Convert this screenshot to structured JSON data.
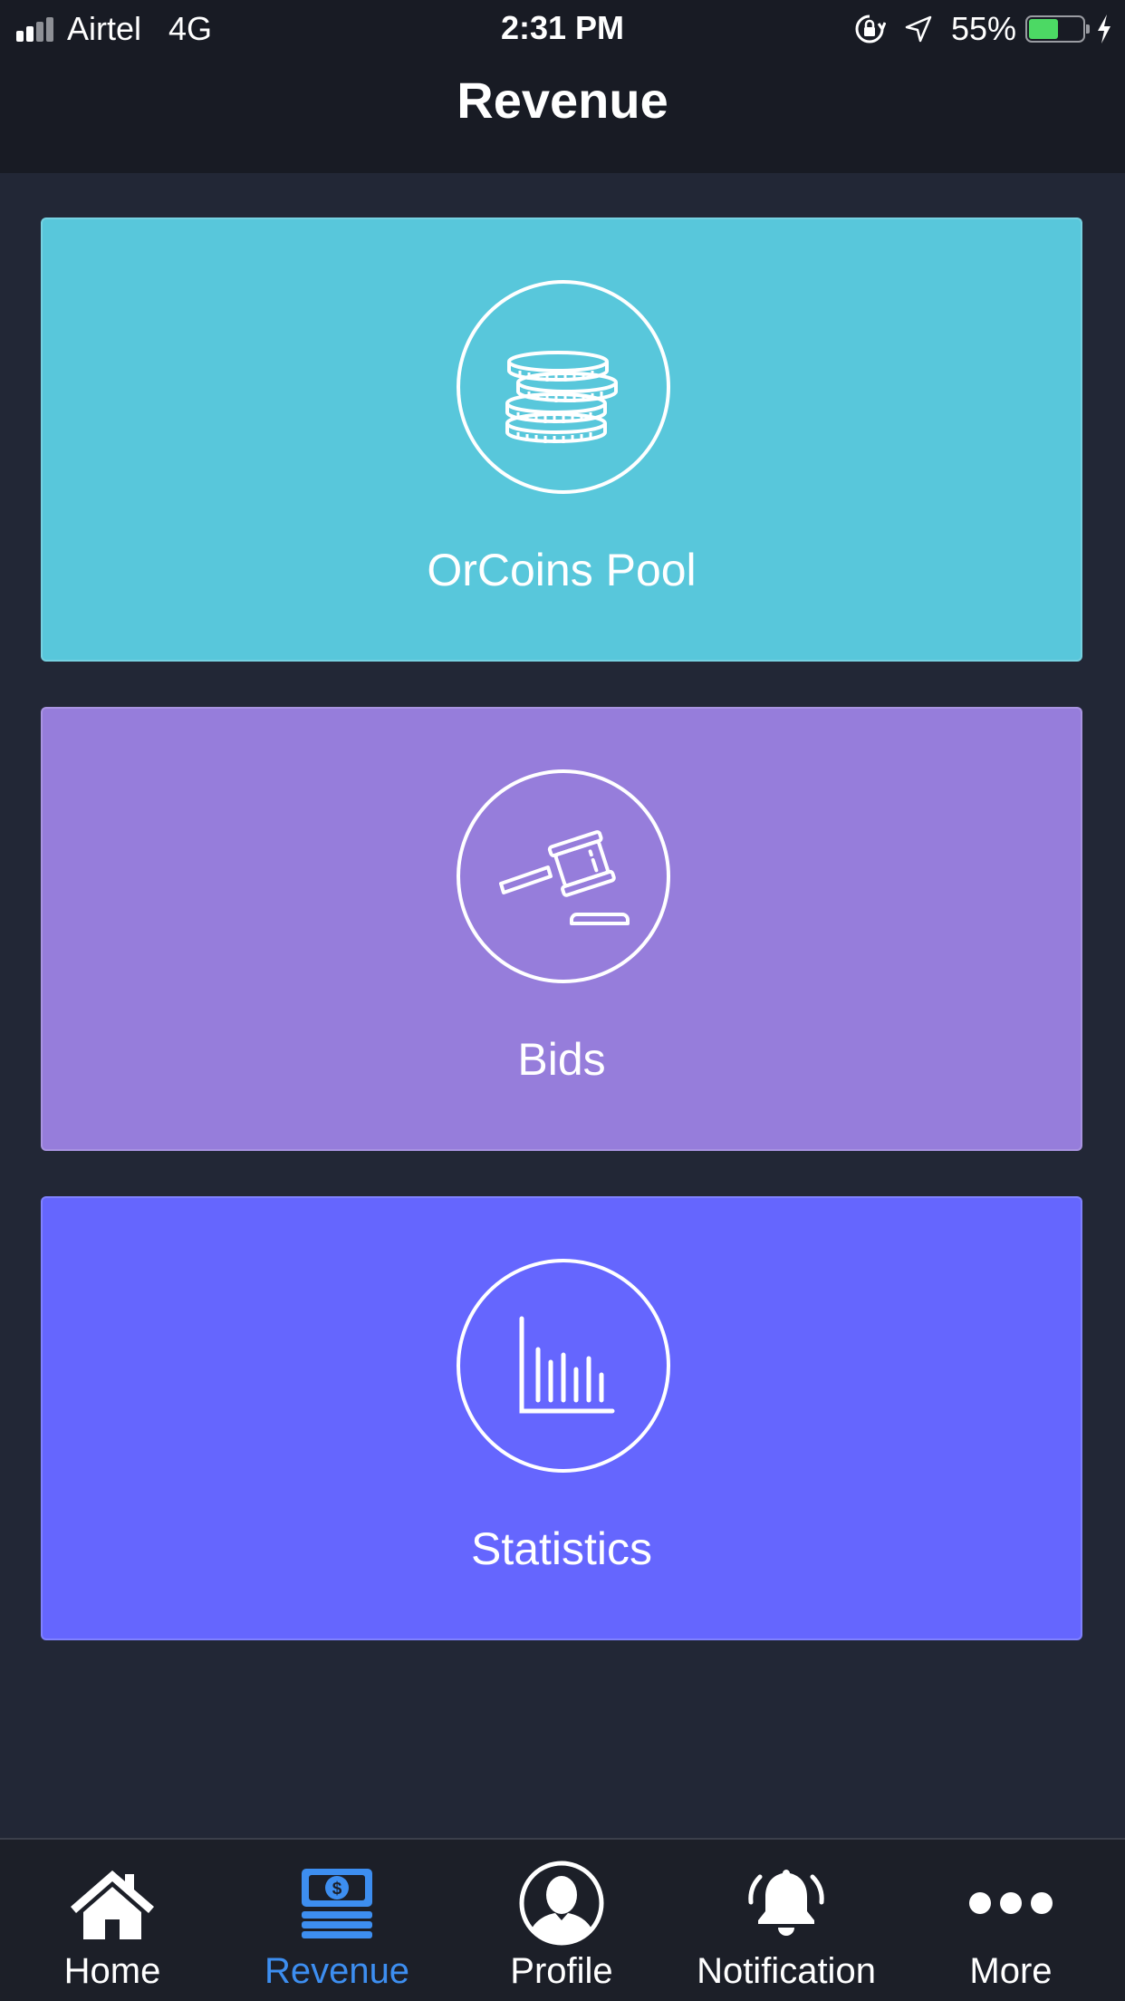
{
  "status_bar": {
    "carrier": "Airtel",
    "network": "4G",
    "time": "2:31 PM",
    "battery": "55%",
    "battery_level": 0.55,
    "icons": [
      "signal-icon",
      "rotation-lock-icon",
      "location-icon",
      "battery-icon",
      "charging-icon"
    ]
  },
  "header": {
    "title": "Revenue"
  },
  "cards": [
    {
      "label": "OrCoins Pool",
      "icon": "coins-icon",
      "color": "#58c7db"
    },
    {
      "label": "Bids",
      "icon": "gavel-icon",
      "color": "#967ddb"
    },
    {
      "label": "Statistics",
      "icon": "bar-chart-icon",
      "color": "#6566fe"
    }
  ],
  "tab_bar": {
    "active_color": "#3d8ef0",
    "tabs": [
      {
        "label": "Home",
        "icon": "home-icon"
      },
      {
        "label": "Revenue",
        "icon": "money-icon",
        "active": true
      },
      {
        "label": "Profile",
        "icon": "profile-icon"
      },
      {
        "label": "Notification",
        "icon": "bell-icon"
      },
      {
        "label": "More",
        "icon": "more-icon"
      }
    ]
  }
}
